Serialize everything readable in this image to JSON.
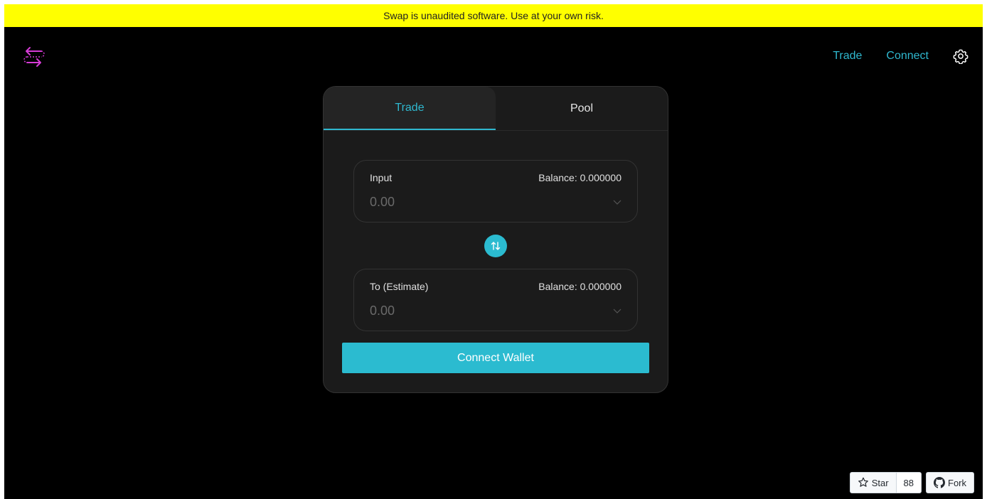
{
  "banner": {
    "text": "Swap is unaudited software. Use at your own risk."
  },
  "nav": {
    "trade": "Trade",
    "connect": "Connect",
    "settings_icon": "gear-icon"
  },
  "tabs": [
    {
      "label": "Trade",
      "active": true
    },
    {
      "label": "Pool",
      "active": false
    }
  ],
  "input_panel": {
    "label": "Input",
    "balance": "Balance: 0.000000",
    "placeholder": "0.00"
  },
  "output_panel": {
    "label": "To (Estimate)",
    "balance": "Balance: 0.000000",
    "placeholder": "0.00"
  },
  "swap_icon": "swap-arrows-icon",
  "connect_button": "Connect Wallet",
  "github": {
    "star_label": "Star",
    "star_count": "88",
    "fork_label": "Fork"
  },
  "colors": {
    "accent": "#2bbbd0",
    "banner": "#ffff00",
    "logo": "#d63bd6",
    "card": "#1b1b1b",
    "background": "#000000"
  }
}
